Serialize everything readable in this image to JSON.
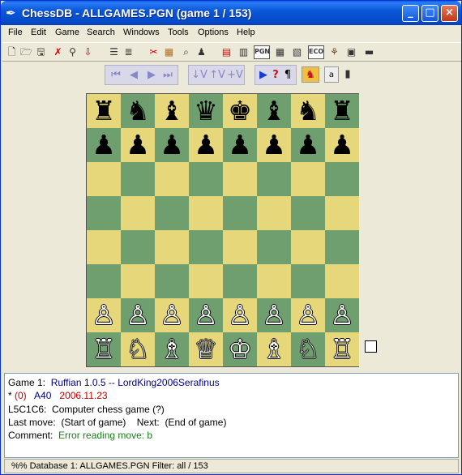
{
  "window": {
    "title": "ChessDB - ALLGAMES.PGN (game 1 / 153)",
    "app_icon": "feather-icon",
    "controls": {
      "minimize": "_",
      "maximize": "□",
      "close": "×"
    }
  },
  "menu": [
    "File",
    "Edit",
    "Game",
    "Search",
    "Windows",
    "Tools",
    "Options",
    "Help"
  ],
  "toolbar": {
    "icons": [
      {
        "name": "new-file-icon",
        "glyph": "🗋"
      },
      {
        "name": "open-file-icon",
        "glyph": "🗁"
      },
      {
        "name": "save-icon",
        "glyph": "🖫"
      },
      {
        "name": "close-db-icon",
        "glyph": "✗"
      },
      {
        "name": "search-icon",
        "glyph": "⚲"
      },
      {
        "name": "import-icon",
        "glyph": "⇩"
      },
      {
        "name": "list-icon",
        "glyph": "☰"
      },
      {
        "name": "list-down-icon",
        "glyph": "≣"
      },
      {
        "name": "cut-pieces-icon",
        "glyph": "✂"
      },
      {
        "name": "board-search-icon",
        "glyph": "▦"
      },
      {
        "name": "header-search-icon",
        "glyph": "⌕"
      },
      {
        "name": "material-search-icon",
        "glyph": "♟"
      },
      {
        "name": "game-list-icon",
        "glyph": "▤"
      },
      {
        "name": "game-browser-icon",
        "glyph": "▥"
      },
      {
        "name": "pgn-window-icon",
        "glyph": "PGN"
      },
      {
        "name": "board-view-icon",
        "glyph": "▦"
      },
      {
        "name": "crosstable-icon",
        "glyph": "▧"
      },
      {
        "name": "eco-browser-icon",
        "glyph": "ECO"
      },
      {
        "name": "tree-icon",
        "glyph": "⚘"
      },
      {
        "name": "player-info-icon",
        "glyph": "▣"
      },
      {
        "name": "engine-icon",
        "glyph": "▬"
      }
    ]
  },
  "navigation": {
    "move_nav": [
      "⏮",
      "◀",
      "▶",
      "⏭"
    ],
    "variation_nav": [
      "↓V",
      "↑V",
      "+V"
    ],
    "game_actions": [
      {
        "name": "auto-play-icon",
        "glyph": "▶"
      },
      {
        "name": "hint-icon",
        "glyph": "?"
      },
      {
        "name": "comment-icon",
        "glyph": "¶"
      },
      {
        "name": "flip-board-icon",
        "glyph": "♞"
      },
      {
        "name": "coordinates-icon",
        "glyph": "a"
      },
      {
        "name": "material-icon",
        "glyph": "▮"
      }
    ]
  },
  "board": {
    "ranks": [
      [
        "♜",
        "♞",
        "♝",
        "♛",
        "♚",
        "♝",
        "♞",
        "♜"
      ],
      [
        "♟",
        "♟",
        "♟",
        "♟",
        "♟",
        "♟",
        "♟",
        "♟"
      ],
      [
        "",
        "",
        "",
        "",
        "",
        "",
        "",
        ""
      ],
      [
        "",
        "",
        "",
        "",
        "",
        "",
        "",
        ""
      ],
      [
        "",
        "",
        "",
        "",
        "",
        "",
        "",
        ""
      ],
      [
        "",
        "",
        "",
        "",
        "",
        "",
        "",
        ""
      ],
      [
        "♙",
        "♙",
        "♙",
        "♙",
        "♙",
        "♙",
        "♙",
        "♙"
      ],
      [
        "♖",
        "♘",
        "♗",
        "♕",
        "♔",
        "♗",
        "♘",
        "♖"
      ]
    ],
    "colors": {
      "light": "#e6d77a",
      "dark": "#6f9f6f"
    }
  },
  "game_info": {
    "game_label": "Game 1:",
    "players": "Ruffian 1.0.5  --  LordKing2006Serafinus",
    "result_marker": "*",
    "result": "(0)",
    "eco": "A40",
    "date": "2006.11.23",
    "event_code": "L5C1C6:",
    "event": "Computer chess game (?)",
    "last_move_label": "Last move:",
    "last_move": "(Start of game)",
    "next_label": "Next:",
    "next_move": "(End of game)",
    "comment_label": "Comment:",
    "comment": "Error reading move: b"
  },
  "status": {
    "text": "%%  Database 1: ALLGAMES.PGN  Filter: all / 153"
  }
}
